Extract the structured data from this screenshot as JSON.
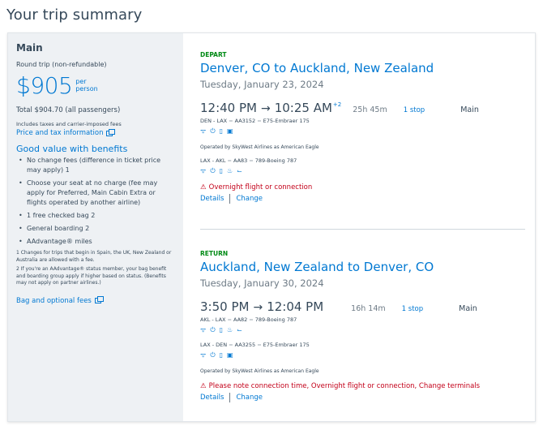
{
  "page": {
    "title": "Your trip summary"
  },
  "fare": {
    "name": "Main",
    "subtitle": "Round trip (non-refundable)",
    "price": "$905",
    "per_1": "per",
    "per_2": "person",
    "total": "Total $904.70 (all passengers)",
    "taxes_note": "Includes taxes and carrier-imposed fees",
    "price_tax_link": "Price and tax information",
    "benefits_title": "Good value with benefits",
    "benefits": [
      "No change fees (difference in ticket price may apply) 1",
      "Choose your seat at no charge (fee may apply for Preferred, Main Cabin Extra or flights operated by another airline)",
      "1 free checked bag 2",
      "General boarding 2",
      "AAdvantage® miles"
    ],
    "footnote_1": "1 Changes for trips that begin in Spain, the UK, New Zealand or Australia are allowed with a fee.",
    "footnote_2": "2 If you're an AAdvantage® status member, your bag benefit and boarding group apply if higher based on status. (Benefits may not apply on partner airlines.)",
    "bag_link": "Bag and optional fees"
  },
  "depart": {
    "label": "DEPART",
    "route": "Denver, CO to Auckland, New Zealand",
    "date": "Tuesday, January 23, 2024",
    "dep_time": "12:40 PM",
    "arrow": "→",
    "arr_time": "10:25 AM",
    "day_offset": "+2",
    "duration": "25h 45m",
    "stops": "1 stop",
    "cabin": "Main",
    "flight1_route": "DEN - LAX",
    "flight1_number": "AA3152",
    "flight1_aircraft": "E75-Embraer 175",
    "flight1_operated": "Operated by SkyWest Airlines as American Eagle",
    "flight2_route": "LAX - AKL",
    "flight2_number": "AA83",
    "flight2_aircraft": "789-Boeing 787",
    "warning": "Overnight flight or connection",
    "details": "Details",
    "change": "Change"
  },
  "return": {
    "label": "RETURN",
    "route": "Auckland, New Zealand to Denver, CO",
    "date": "Tuesday, January 30, 2024",
    "dep_time": "3:50 PM",
    "arrow": "→",
    "arr_time": "12:04 PM",
    "duration": "16h 14m",
    "stops": "1 stop",
    "cabin": "Main",
    "flight1_route": "AKL - LAX",
    "flight1_number": "AA82",
    "flight1_aircraft": "789-Boeing 787",
    "flight2_route": "LAX - DEN",
    "flight2_number": "AA3255",
    "flight2_aircraft": "E75-Embraer 175",
    "flight2_operated": "Operated by SkyWest Airlines as American Eagle",
    "warning": "Please note connection time, Overnight flight or connection, Change terminals",
    "details": "Details",
    "change": "Change"
  },
  "icons": {
    "wifi": "wifi-icon",
    "power": "power-icon",
    "usb": "usb-icon",
    "entertainment": "entertainment-icon",
    "food": "food-icon",
    "lie_flat": "lie-flat-seat-icon",
    "warning": "warning-icon",
    "external": "external-link-icon"
  },
  "colors": {
    "accent": "#0078d2",
    "green": "#008a15",
    "warning": "#c30019",
    "text": "#36495a",
    "panel": "#eef1f4"
  }
}
